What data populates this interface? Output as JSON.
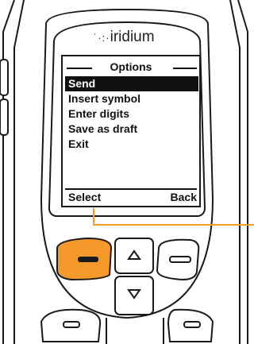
{
  "brand": {
    "dots": "˙·:·",
    "name": "iridium"
  },
  "screen": {
    "title": "Options",
    "menu_items": [
      {
        "label": "Send",
        "selected": true
      },
      {
        "label": "Insert symbol",
        "selected": false
      },
      {
        "label": "Enter digits",
        "selected": false
      },
      {
        "label": "Save as draft",
        "selected": false
      },
      {
        "label": "Exit",
        "selected": false
      }
    ],
    "softkeys": {
      "left": "Select",
      "right": "Back"
    }
  },
  "colors": {
    "highlight_key": "#F39A2B",
    "callout_line": "#F39A2B",
    "body_outline": "#1a1a1a"
  },
  "icons": {
    "up": "triangle-up-icon",
    "down": "triangle-down-icon",
    "left_soft": "minus-icon",
    "right_soft": "minus-icon"
  }
}
